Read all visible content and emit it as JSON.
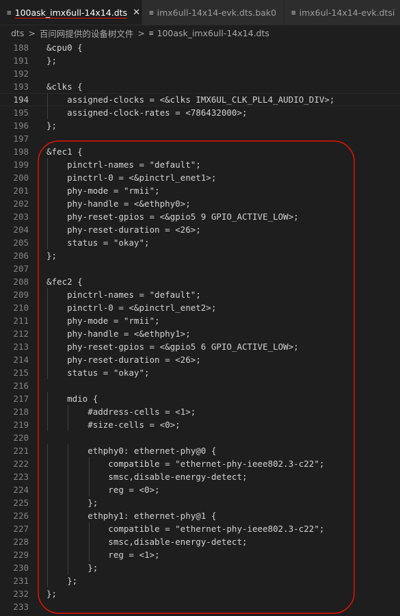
{
  "tabs": [
    {
      "label": "100ask_imx6ull-14x14.dts",
      "icon": "devicetree-file-icon",
      "close": "✕"
    },
    {
      "label": "imx6ull-14x14-evk.dts.bak0",
      "icon": "file-lines-icon"
    },
    {
      "label": "imx6ul-14x14-evk.dtsi",
      "icon": "file-lines-icon"
    }
  ],
  "breadcrumb": {
    "parts": [
      "dts",
      "百问网提供的设备树文件",
      "100ask_imx6ull-14x14.dts"
    ],
    "separator": ">"
  },
  "editor": {
    "current_line": 194,
    "lines": [
      {
        "n": 188,
        "text": "&cpu0 {"
      },
      {
        "n": 191,
        "text": "};"
      },
      {
        "n": 192,
        "text": ""
      },
      {
        "n": 193,
        "text": "&clks {"
      },
      {
        "n": 194,
        "text": "    assigned-clocks = <&clks IMX6UL_CLK_PLL4_AUDIO_DIV>;"
      },
      {
        "n": 195,
        "text": "    assigned-clock-rates = <786432000>;"
      },
      {
        "n": 196,
        "text": "};"
      },
      {
        "n": 197,
        "text": ""
      },
      {
        "n": 198,
        "text": "&fec1 {"
      },
      {
        "n": 199,
        "text": "    pinctrl-names = \"default\";"
      },
      {
        "n": 200,
        "text": "    pinctrl-0 = <&pinctrl_enet1>;"
      },
      {
        "n": 201,
        "text": "    phy-mode = \"rmii\";"
      },
      {
        "n": 202,
        "text": "    phy-handle = <&ethphy0>;"
      },
      {
        "n": 203,
        "text": "    phy-reset-gpios = <&gpio5 9 GPIO_ACTIVE_LOW>;"
      },
      {
        "n": 204,
        "text": "    phy-reset-duration = <26>;"
      },
      {
        "n": 205,
        "text": "    status = \"okay\";"
      },
      {
        "n": 206,
        "text": "};"
      },
      {
        "n": 207,
        "text": ""
      },
      {
        "n": 208,
        "text": "&fec2 {"
      },
      {
        "n": 209,
        "text": "    pinctrl-names = \"default\";"
      },
      {
        "n": 210,
        "text": "    pinctrl-0 = <&pinctrl_enet2>;"
      },
      {
        "n": 211,
        "text": "    phy-mode = \"rmii\";"
      },
      {
        "n": 212,
        "text": "    phy-handle = <&ethphy1>;"
      },
      {
        "n": 213,
        "text": "    phy-reset-gpios = <&gpio5 6 GPIO_ACTIVE_LOW>;"
      },
      {
        "n": 214,
        "text": "    phy-reset-duration = <26>;"
      },
      {
        "n": 215,
        "text": "    status = \"okay\";"
      },
      {
        "n": 216,
        "text": ""
      },
      {
        "n": 217,
        "text": "    mdio {"
      },
      {
        "n": 218,
        "text": "        #address-cells = <1>;"
      },
      {
        "n": 219,
        "text": "        #size-cells = <0>;"
      },
      {
        "n": 220,
        "text": ""
      },
      {
        "n": 221,
        "text": "        ethphy0: ethernet-phy@0 {"
      },
      {
        "n": 222,
        "text": "            compatible = \"ethernet-phy-ieee802.3-c22\";"
      },
      {
        "n": 223,
        "text": "            smsc,disable-energy-detect;"
      },
      {
        "n": 224,
        "text": "            reg = <0>;"
      },
      {
        "n": 225,
        "text": "        };"
      },
      {
        "n": 226,
        "text": "        ethphy1: ethernet-phy@1 {"
      },
      {
        "n": 227,
        "text": "            compatible = \"ethernet-phy-ieee802.3-c22\";"
      },
      {
        "n": 228,
        "text": "            smsc,disable-energy-detect;"
      },
      {
        "n": 229,
        "text": "            reg = <1>;"
      },
      {
        "n": 230,
        "text": "        };"
      },
      {
        "n": 231,
        "text": "    };"
      },
      {
        "n": 232,
        "text": "};"
      },
      {
        "n": 233,
        "text": ""
      }
    ]
  },
  "colors": {
    "editor_bg": "#1e1e1e",
    "annotation": "#e51400"
  }
}
